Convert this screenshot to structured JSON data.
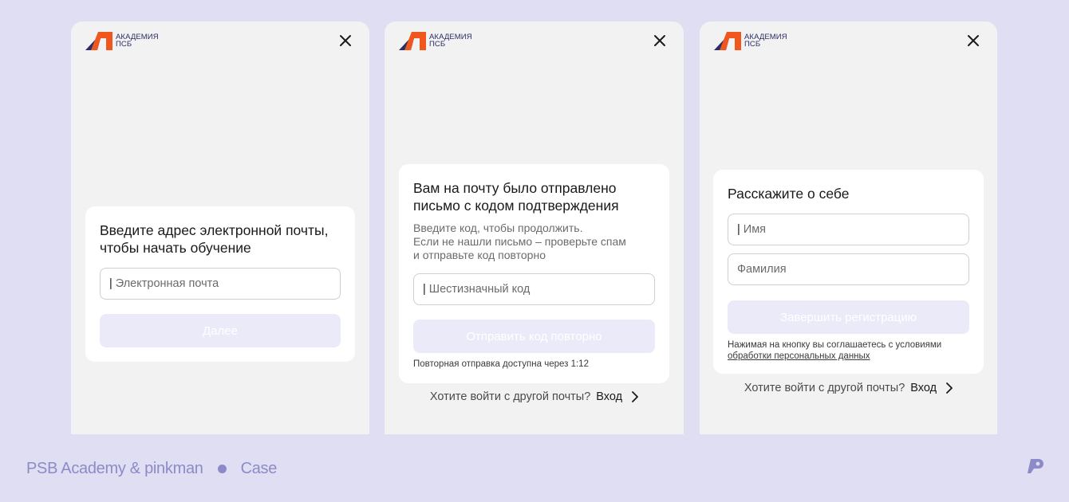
{
  "logo": {
    "line1": "АКАДЕМИЯ",
    "line2": "ПСБ"
  },
  "screen1": {
    "title_line1": "Введите адрес электронной почты,",
    "title_line2": "чтобы начать обучение",
    "email_placeholder": "Электронная почта",
    "next_button": "Далее"
  },
  "screen2": {
    "title_line1": "Вам на почту было отправлено",
    "title_line2": "письмо с кодом подтверждения",
    "desc_line1": "Введите код, чтобы продолжить.",
    "desc_line2": "Если не нашли письмо – проверьте спам",
    "desc_line3": "и отправьте код повторно",
    "code_placeholder": "Шестизначный код",
    "resend_button": "Отправить код повторно",
    "resend_note": "Повторная отправка доступна через 1:12",
    "switch_text": "Хотите войти с другой почты?",
    "login_link": "Вход"
  },
  "screen3": {
    "title": "Расскажите о себе",
    "first_name_placeholder": "Имя",
    "last_name_placeholder": "Фамилия",
    "finish_button": "Завершить регистрацию",
    "agreement_text": "Нажимая на кнопку вы соглашаетесь с условиями",
    "agreement_link": "обработки персональных данных",
    "switch_text": "Хотите войти с другой почты?",
    "login_link": "Вход"
  },
  "footer": {
    "project": "PSB Academy & pinkman",
    "section": "Case"
  },
  "colors": {
    "background": "#dfdef3",
    "screen": "#f2f2f2",
    "logo_orange": "#f0571e",
    "logo_navy": "#2b2d66",
    "disabled_button": "#ebeaf8",
    "footer_text": "#8c8bc8"
  }
}
